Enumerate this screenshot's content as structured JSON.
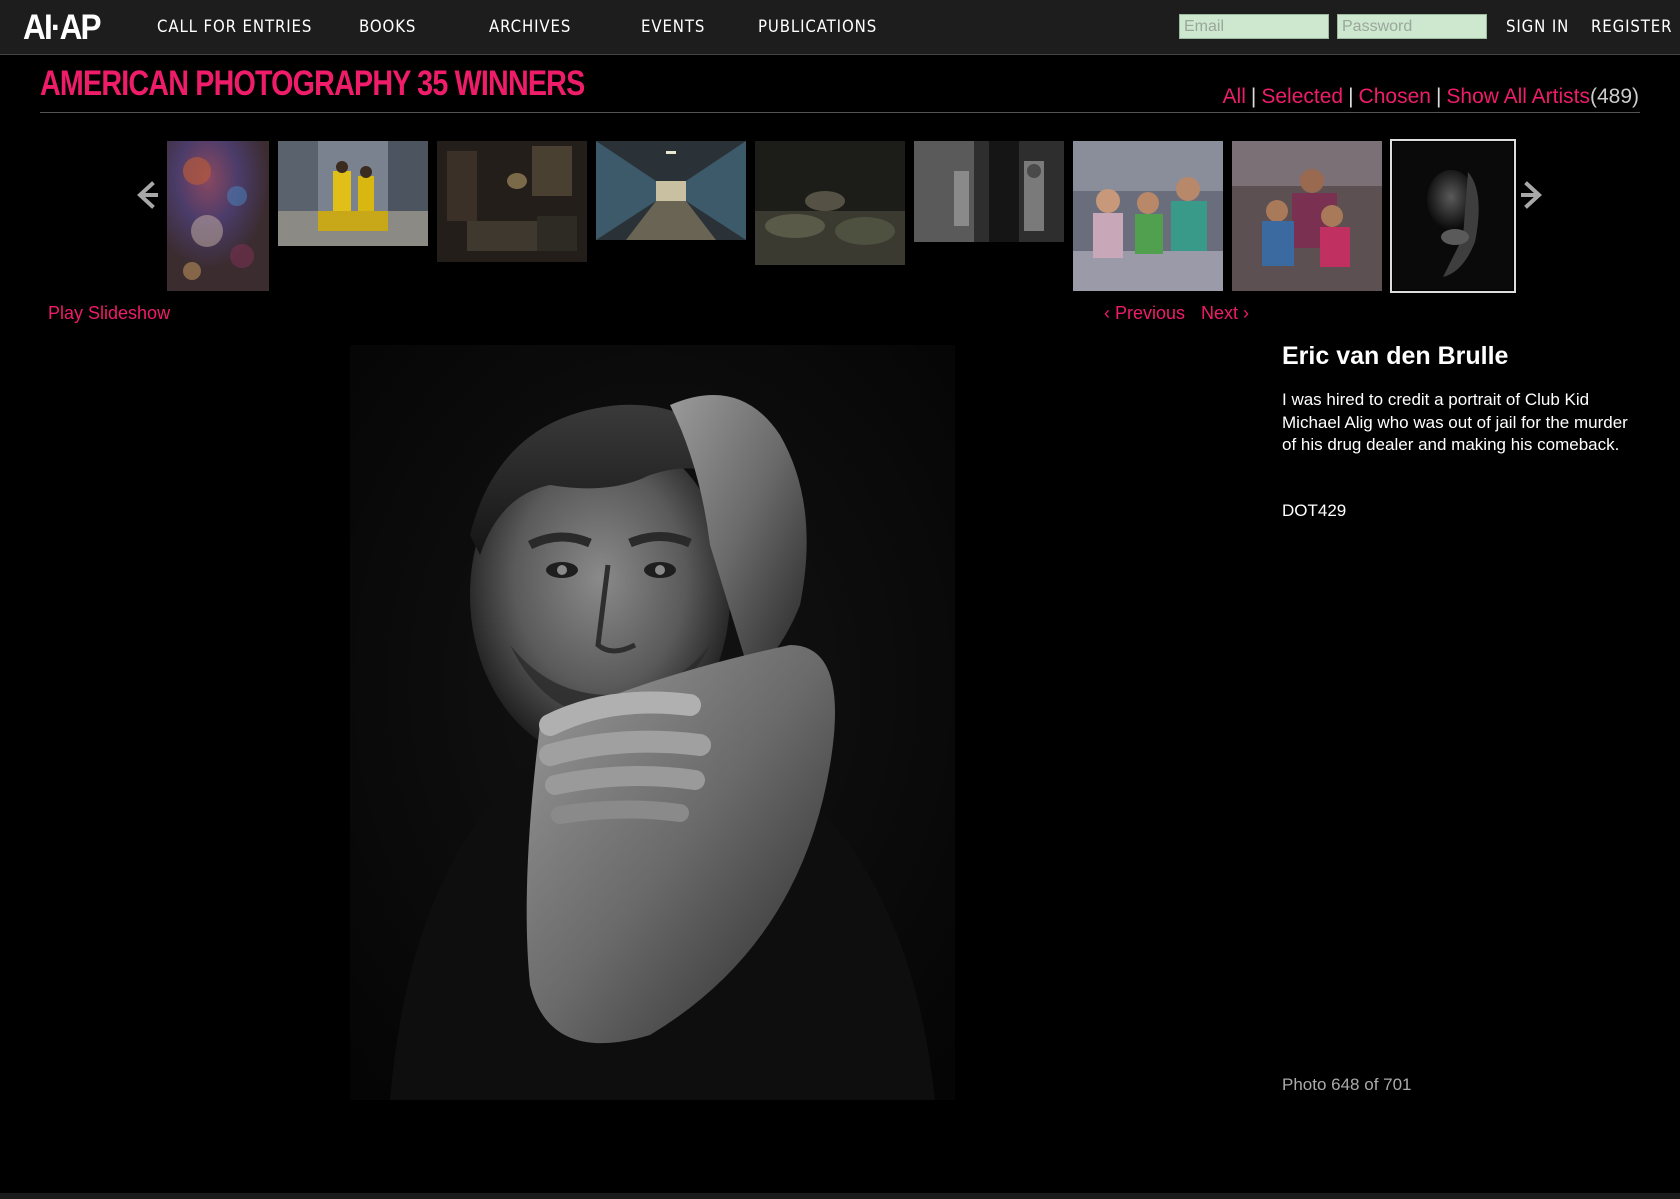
{
  "header": {
    "logo": "AI·AP",
    "nav": [
      {
        "label": "Call for Entries"
      },
      {
        "label": "Books"
      },
      {
        "label": "Archives"
      },
      {
        "label": "Events"
      },
      {
        "label": "Publications"
      }
    ],
    "email_placeholder": "Email",
    "password_placeholder": "Password",
    "sign_in": "SIGN IN",
    "register": "REGISTER"
  },
  "section": {
    "title": "AMERICAN PHOTOGRAPHY 35 WINNERS",
    "filters": {
      "all": "All",
      "selected": "Selected",
      "chosen": "Chosen",
      "show_all_artists": "Show All Artists",
      "separator": "|",
      "count": "(489)"
    }
  },
  "thumbnails": {
    "prev_icon": "arrow-left-icon",
    "next_icon": "arrow-right-icon",
    "items": [
      {
        "subject": "abstract colorful texture",
        "tone": "#5a3a44"
      },
      {
        "subject": "workers in yellow suits on street",
        "tone": "#6a6e78"
      },
      {
        "subject": "dim living room interior",
        "tone": "#2e2822"
      },
      {
        "subject": "library corridor with shelves",
        "tone": "#3a4248"
      },
      {
        "subject": "people lying on floor",
        "tone": "#3a3a30"
      },
      {
        "subject": "black and white doorway scene",
        "tone": "#4a4a4a"
      },
      {
        "subject": "mother and children seated",
        "tone": "#6a6a7a"
      },
      {
        "subject": "family group with children",
        "tone": "#5a4c50"
      },
      {
        "subject": "black and white portrait",
        "tone": "#2a2a2a",
        "active": true
      }
    ]
  },
  "controls": {
    "play_slideshow": "Play Slideshow",
    "previous": "‹ Previous",
    "next": "Next ›"
  },
  "photo": {
    "subject": "black and white portrait of man with hand on head and forearm across face"
  },
  "info": {
    "artist": "Eric van den Brulle",
    "caption": "I was hired to credit a portrait of Club Kid Michael Alig who was out of jail for the murder of his drug dealer and making his comeback.",
    "code": "DOT429",
    "photo_count": "Photo 648 of 701"
  },
  "colors": {
    "accent": "#ef1c6a",
    "background": "#000000",
    "topbar": "#1d1d1d",
    "input_bg": "#cde8cf"
  }
}
